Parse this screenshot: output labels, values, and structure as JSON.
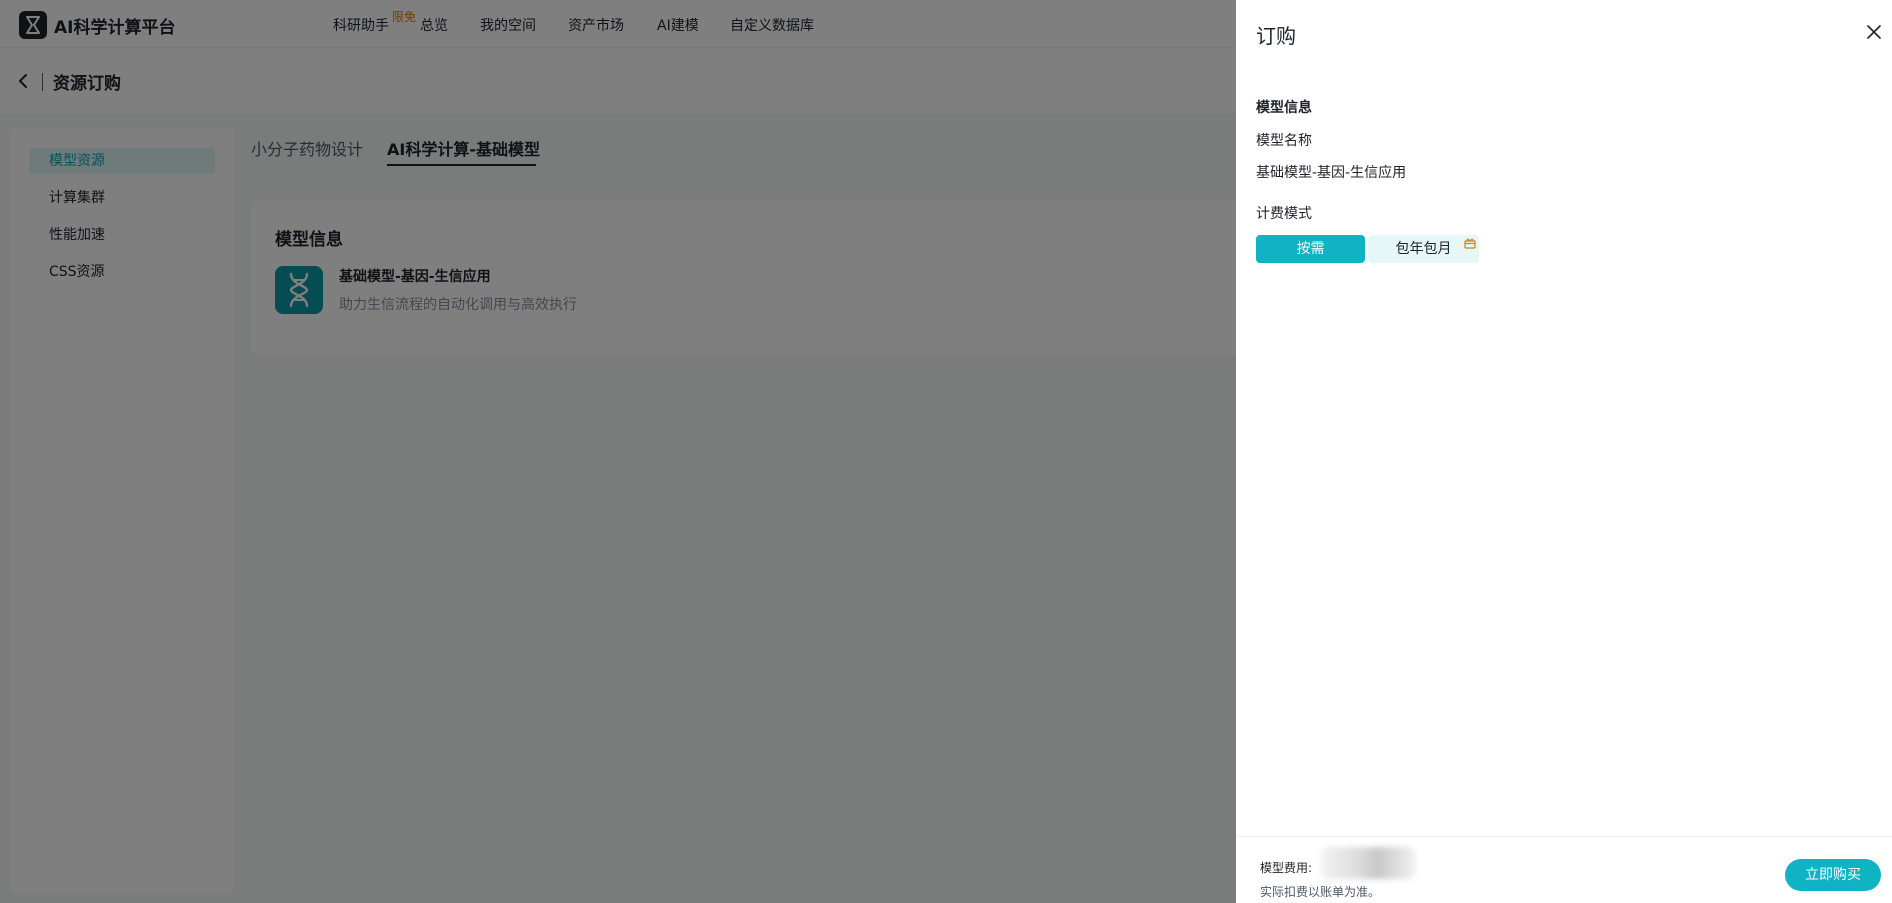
{
  "app": {
    "brand": "AI科学计算平台"
  },
  "nav": {
    "items": [
      {
        "label": "科研助手"
      },
      {
        "label": "总览"
      },
      {
        "label": "我的空间"
      },
      {
        "label": "资产市场"
      },
      {
        "label": "AI建模"
      },
      {
        "label": "自定义数据库"
      }
    ],
    "badge": "限免"
  },
  "page": {
    "title": "资源订购"
  },
  "sidebar": {
    "items": [
      {
        "label": "模型资源",
        "active": true
      },
      {
        "label": "计算集群",
        "active": false
      },
      {
        "label": "性能加速",
        "active": false
      },
      {
        "label": "CSS资源",
        "active": false
      }
    ]
  },
  "tabs": [
    {
      "label": "小分子药物设计",
      "active": false
    },
    {
      "label": "AI科学计算-基础模型",
      "active": true
    }
  ],
  "card": {
    "title": "模型信息",
    "model_name": "基础模型-基因-生信应用",
    "model_desc": "助力生信流程的自动化调用与高效执行",
    "icon": "dna-icon"
  },
  "drawer": {
    "title": "订购",
    "section_title": "模型信息",
    "model_name_label": "模型名称",
    "model_name_value": "基础模型-基因-生信应用",
    "billing_label": "计费模式",
    "billing_options": [
      {
        "label": "按需",
        "selected": true
      },
      {
        "label": "包年包月",
        "selected": false
      }
    ],
    "fee_label": "模型费用:",
    "fee_note": "实际扣费以账单为准。",
    "buy_button": "立即购买"
  },
  "colors": {
    "accent": "#10b3c4",
    "badge": "#e57b00",
    "overlay": "rgba(0,0,0,0.5)"
  }
}
